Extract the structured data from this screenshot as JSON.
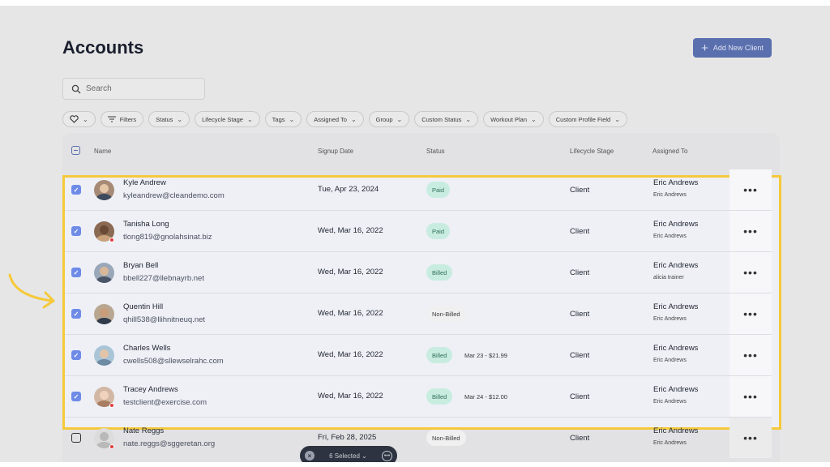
{
  "page": {
    "title": "Accounts",
    "add_button_label": "Add New Client",
    "search_placeholder": "Search"
  },
  "filters": [
    "Filters",
    "Status",
    "Lifecycle Stage",
    "Tags",
    "Assigned To",
    "Group",
    "Custom Status",
    "Workout Plan",
    "Custom Profile Field"
  ],
  "table": {
    "columns": {
      "name": "Name",
      "signup_date": "Signup Date",
      "status": "Status",
      "lifecycle_stage": "Lifecycle Stage",
      "assigned_to": "Assigned To"
    },
    "rows": [
      {
        "name": "Kyle Andrew",
        "email": "kyleandrew@cleandemo.com",
        "date": "Tue, Apr 23, 2024",
        "status": "Paid",
        "amount": "",
        "stage": "Client",
        "assigned": "Eric Andrews",
        "assigned_sub": "Eric Andrews"
      },
      {
        "name": "Tanisha Long",
        "email": "tlong819@gnolahsinat.biz",
        "date": "Wed, Mar 16, 2022",
        "status": "Paid",
        "amount": "",
        "stage": "Client",
        "assigned": "Eric Andrews",
        "assigned_sub": "Eric Andrews"
      },
      {
        "name": "Bryan Bell",
        "email": "bbell227@llebnayrb.net",
        "date": "Wed, Mar 16, 2022",
        "status": "Billed",
        "amount": "",
        "stage": "Client",
        "assigned": "Eric Andrews",
        "assigned_sub": "alicia trainer"
      },
      {
        "name": "Quentin Hill",
        "email": "qhill538@llihnitneuq.net",
        "date": "Wed, Mar 16, 2022",
        "status": "Non-Billed",
        "amount": "",
        "stage": "Client",
        "assigned": "Eric Andrews",
        "assigned_sub": "Eric Andrews"
      },
      {
        "name": "Charles Wells",
        "email": "cwells508@sllewselrahc.com",
        "date": "Wed, Mar 16, 2022",
        "status": "Billed",
        "amount": "Mar 23 - $21.99",
        "stage": "Client",
        "assigned": "Eric Andrews",
        "assigned_sub": "Eric Andrews"
      },
      {
        "name": "Tracey Andrews",
        "email": "testclient@exercise.com",
        "date": "Wed, Mar 16, 2022",
        "status": "Billed",
        "amount": "Mar 24 - $12.00",
        "stage": "Client",
        "assigned": "Eric Andrews",
        "assigned_sub": "Eric Andrews"
      },
      {
        "name": "Nate Reggs",
        "email": "nate.reggs@sggeretan.org",
        "date": "Fri, Feb 28, 2025",
        "status": "Non-Billed",
        "amount": "",
        "stage": "Client",
        "assigned": "Eric Andrews",
        "assigned_sub": "Eric Andrews"
      }
    ]
  },
  "selection_bar": {
    "label": "6 Selected"
  },
  "colors": {
    "accent": "#5a6fae",
    "highlight": "#f5c93a",
    "checkbox": "#6f8be8",
    "paid_badge": "#c9ece0"
  },
  "icons": {
    "search": "search-icon",
    "heart": "heart-icon",
    "filter": "filter-icon",
    "more": "more-icon",
    "close": "close-icon"
  }
}
